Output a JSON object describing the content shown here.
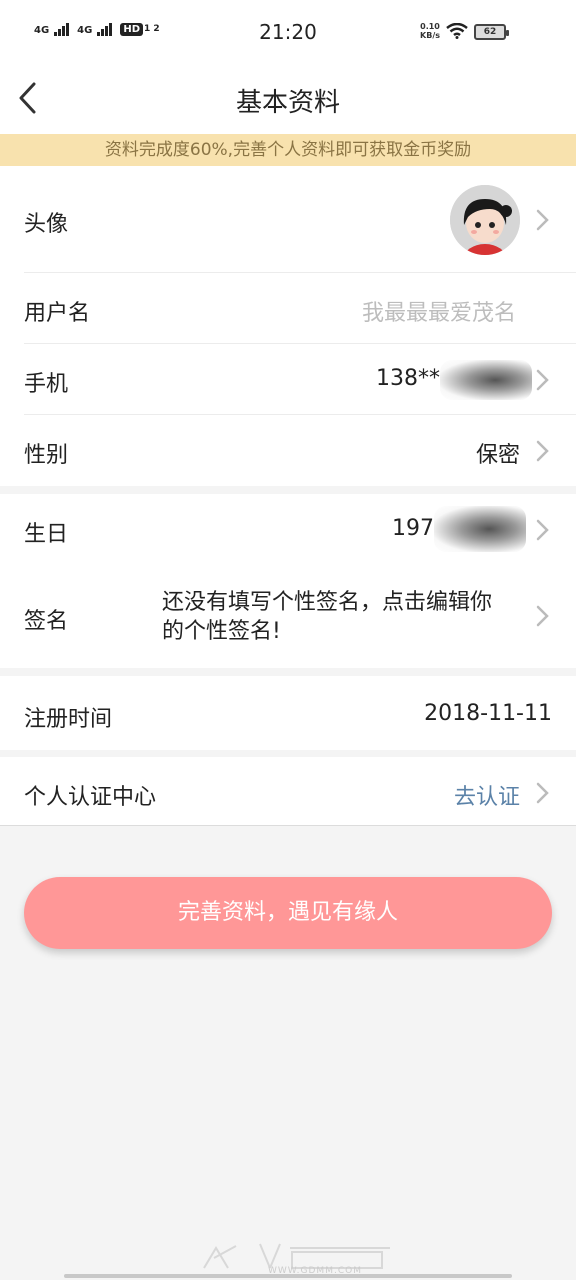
{
  "status_bar": {
    "sim1_label": "4G",
    "sim2_label": "4G",
    "hd_label": "HD",
    "hd_sub": "1 2",
    "time": "21:20",
    "net_speed_value": "0.10",
    "net_speed_unit": "KB/s",
    "battery": "62"
  },
  "header": {
    "back_icon": "chevron-left-icon",
    "title": "基本资料"
  },
  "banner": {
    "text": "资料完成度60%,完善个人资料即可获取金币奖励"
  },
  "rows": {
    "avatar": {
      "label": "头像"
    },
    "username": {
      "label": "用户名",
      "placeholder": "我最最最爱茂名"
    },
    "phone": {
      "label": "手机",
      "value": "138**"
    },
    "gender": {
      "label": "性别",
      "value": "保密"
    },
    "birthday": {
      "label": "生日",
      "value": "197"
    },
    "signature": {
      "label": "签名",
      "value": "还没有填写个性签名，点击编辑你的个性签名!"
    },
    "register_time": {
      "label": "注册时间",
      "value": "2018-11-11"
    },
    "verify": {
      "label": "个人认证中心",
      "value": "去认证",
      "value_color": "#5b82a8"
    }
  },
  "cta": {
    "label": "完善资料，遇见有缘人",
    "color": "#ff9797"
  },
  "watermark": {
    "text": "WWW.GDMM.COM"
  }
}
